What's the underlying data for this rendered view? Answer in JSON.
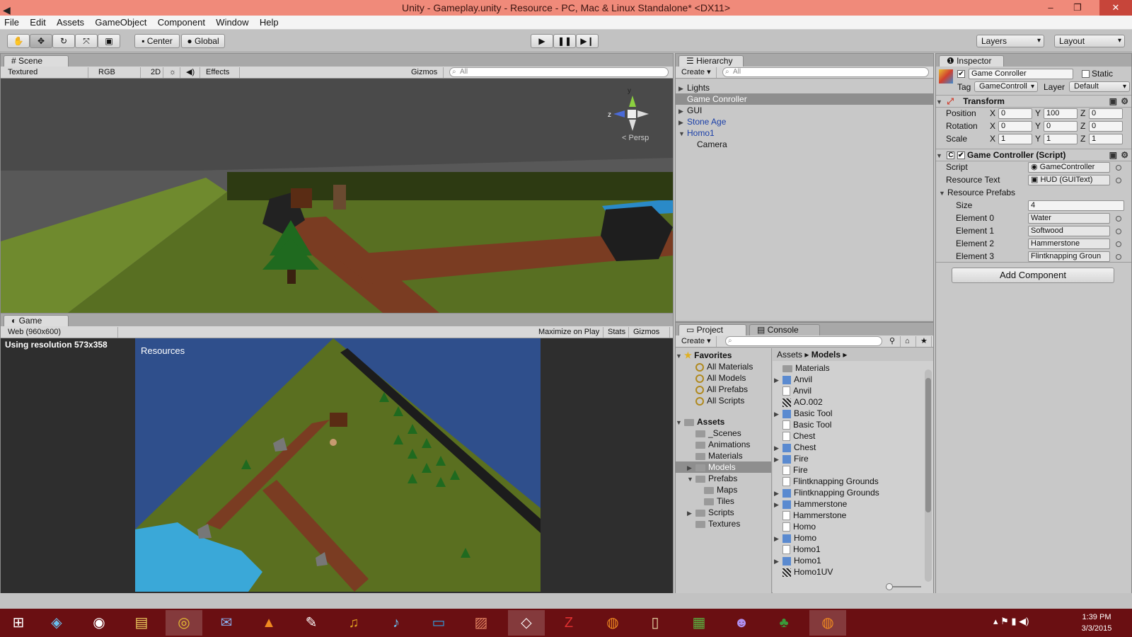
{
  "window": {
    "title": "Unity - Gameplay.unity - Resource - PC, Mac & Linux Standalone* <DX11>"
  },
  "menu": [
    "File",
    "Edit",
    "Assets",
    "GameObject",
    "Component",
    "Window",
    "Help"
  ],
  "toolbar": {
    "center": "Center",
    "global": "Global",
    "layers": "Layers",
    "layout": "Layout"
  },
  "scene": {
    "tab": "Scene",
    "shading": "Textured",
    "render": "RGB",
    "mode2d": "2D",
    "effects": "Effects",
    "gizmos": "Gizmos",
    "search_placeholder": "All",
    "persp": "Persp",
    "axis_y": "y",
    "axis_z": "z"
  },
  "game": {
    "tab": "Game",
    "resolution": "Web (960x600)",
    "maximize": "Maximize on Play",
    "stats": "Stats",
    "gizmos": "Gizmos",
    "res_info": "Using resolution 573x358",
    "hud_text": "Resources"
  },
  "hierarchy": {
    "tab": "Hierarchy",
    "create": "Create",
    "search_placeholder": "All",
    "items": [
      {
        "label": "Lights",
        "arrow": "▶",
        "prefab": false,
        "selected": false,
        "indent": 0
      },
      {
        "label": "Game Conroller",
        "arrow": "",
        "prefab": false,
        "selected": true,
        "indent": 0
      },
      {
        "label": "GUI",
        "arrow": "▶",
        "prefab": false,
        "selected": false,
        "indent": 0
      },
      {
        "label": "Stone Age",
        "arrow": "▶",
        "prefab": true,
        "selected": false,
        "indent": 0
      },
      {
        "label": "Homo1",
        "arrow": "▼",
        "prefab": true,
        "selected": false,
        "indent": 0
      },
      {
        "label": "Camera",
        "arrow": "",
        "prefab": false,
        "selected": false,
        "indent": 1
      }
    ]
  },
  "inspector": {
    "tab": "Inspector",
    "object_name": "Game Conroller",
    "static_label": "Static",
    "tag_label": "Tag",
    "tag_value": "GameControll",
    "layer_label": "Layer",
    "layer_value": "Default",
    "transform": {
      "title": "Transform",
      "position_label": "Position",
      "rotation_label": "Rotation",
      "scale_label": "Scale",
      "x": "X",
      "y": "Y",
      "z": "Z",
      "position": [
        "0",
        "100",
        "0"
      ],
      "rotation": [
        "0",
        "0",
        "0"
      ],
      "scale": [
        "1",
        "1",
        "1"
      ]
    },
    "script_component": {
      "title": "Game Controller (Script)",
      "script_label": "Script",
      "script_value": "GameController",
      "resource_text_label": "Resource Text",
      "resource_text_value": "HUD (GUIText)",
      "prefabs_label": "Resource Prefabs",
      "size_label": "Size",
      "size_value": "4",
      "elements": [
        {
          "label": "Element 0",
          "value": "Water"
        },
        {
          "label": "Element 1",
          "value": "Softwood"
        },
        {
          "label": "Element 2",
          "value": "Hammerstone"
        },
        {
          "label": "Element 3",
          "value": "Flintknapping Groun"
        }
      ]
    },
    "add_component": "Add Component"
  },
  "project": {
    "tab": "Project",
    "console_tab": "Console",
    "create": "Create",
    "favorites_label": "Favorites",
    "favorites": [
      "All Materials",
      "All Models",
      "All Prefabs",
      "All Scripts"
    ],
    "assets_label": "Assets",
    "tree": [
      {
        "label": "_Scenes",
        "indent": 1,
        "arrow": "",
        "selected": false
      },
      {
        "label": "Animations",
        "indent": 1,
        "arrow": "",
        "selected": false
      },
      {
        "label": "Materials",
        "indent": 1,
        "arrow": "",
        "selected": false
      },
      {
        "label": "Models",
        "indent": 1,
        "arrow": "▶",
        "selected": true
      },
      {
        "label": "Prefabs",
        "indent": 1,
        "arrow": "▼",
        "selected": false
      },
      {
        "label": "Maps",
        "indent": 2,
        "arrow": "",
        "selected": false
      },
      {
        "label": "Tiles",
        "indent": 2,
        "arrow": "",
        "selected": false
      },
      {
        "label": "Scripts",
        "indent": 1,
        "arrow": "▶",
        "selected": false
      },
      {
        "label": "Textures",
        "indent": 1,
        "arrow": "",
        "selected": false
      }
    ],
    "breadcrumb": [
      "Assets",
      "Models"
    ],
    "files": [
      {
        "label": "Materials",
        "icon": "folder",
        "arrow": ""
      },
      {
        "label": "Anvil",
        "icon": "cube",
        "arrow": "▶"
      },
      {
        "label": "Anvil",
        "icon": "doc",
        "arrow": ""
      },
      {
        "label": "AO.002",
        "icon": "texture",
        "arrow": ""
      },
      {
        "label": "Basic Tool",
        "icon": "cube",
        "arrow": "▶"
      },
      {
        "label": "Basic Tool",
        "icon": "doc",
        "arrow": ""
      },
      {
        "label": "Chest",
        "icon": "doc",
        "arrow": ""
      },
      {
        "label": "Chest",
        "icon": "cube",
        "arrow": "▶"
      },
      {
        "label": "Fire",
        "icon": "cube",
        "arrow": "▶"
      },
      {
        "label": "Fire",
        "icon": "doc",
        "arrow": ""
      },
      {
        "label": "Flintknapping Grounds",
        "icon": "doc",
        "arrow": ""
      },
      {
        "label": "Flintknapping Grounds",
        "icon": "cube",
        "arrow": "▶"
      },
      {
        "label": "Hammerstone",
        "icon": "cube",
        "arrow": "▶"
      },
      {
        "label": "Hammerstone",
        "icon": "doc",
        "arrow": ""
      },
      {
        "label": "Homo",
        "icon": "doc",
        "arrow": ""
      },
      {
        "label": "Homo",
        "icon": "cube",
        "arrow": "▶"
      },
      {
        "label": "Homo1",
        "icon": "doc",
        "arrow": ""
      },
      {
        "label": "Homo1",
        "icon": "cube",
        "arrow": "▶"
      },
      {
        "label": "Homo1UV",
        "icon": "texture",
        "arrow": ""
      }
    ]
  },
  "taskbar": {
    "time": "1:39 PM",
    "date": "3/3/2015",
    "apps": [
      "windows-start",
      "visual-studio",
      "steam",
      "file-explorer",
      "chrome",
      "mail",
      "vlc",
      "sketch",
      "audio",
      "itunes",
      "screen",
      "image-viewer",
      "unity",
      "filezilla",
      "blender",
      "notes",
      "minecraft",
      "cat-app",
      "tree-app",
      "blender-2"
    ]
  },
  "colors": {
    "titlebar": "#f08a7a",
    "taskbar": "#6a0f12",
    "selection": "#8e8e8e",
    "prefab_text": "#1a3fa8"
  }
}
